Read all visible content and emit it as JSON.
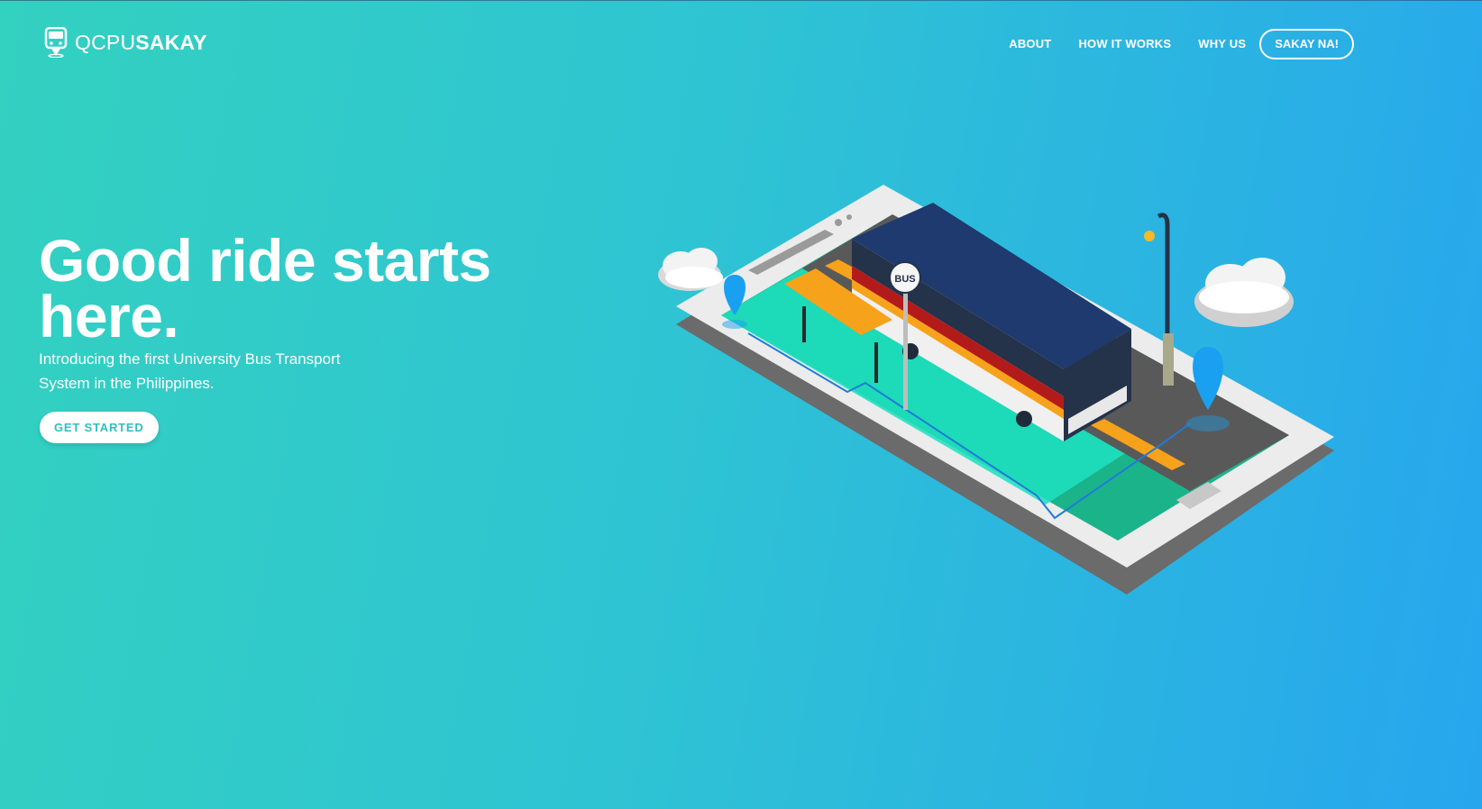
{
  "brand": {
    "light": "QCPU",
    "bold": "SAKAY",
    "icon": "bus-icon"
  },
  "nav": {
    "links": [
      "ABOUT",
      "HOW IT WORKS",
      "WHY US"
    ],
    "cta": "SAKAY NA!"
  },
  "hero": {
    "title_line1": "Good ride starts",
    "title_line2": "here.",
    "subtitle_line1": "Introducing the first University Bus Transport",
    "subtitle_line2": "System in the Philippines.",
    "button": "GET STARTED"
  },
  "illustration": {
    "bus_sign": "BUS",
    "icon": "isometric-phone-bus-illustration"
  },
  "colors": {
    "gradient_start": "#33d1c0",
    "gradient_end": "#27a6ee",
    "button_text": "#2fbfbf",
    "bus_body": "#1e3a6e",
    "bus_stripe_red": "#b31b1b",
    "bus_stripe_orange": "#f7a21b",
    "road": "#5a5a5a",
    "grass": "#1cc57a"
  }
}
